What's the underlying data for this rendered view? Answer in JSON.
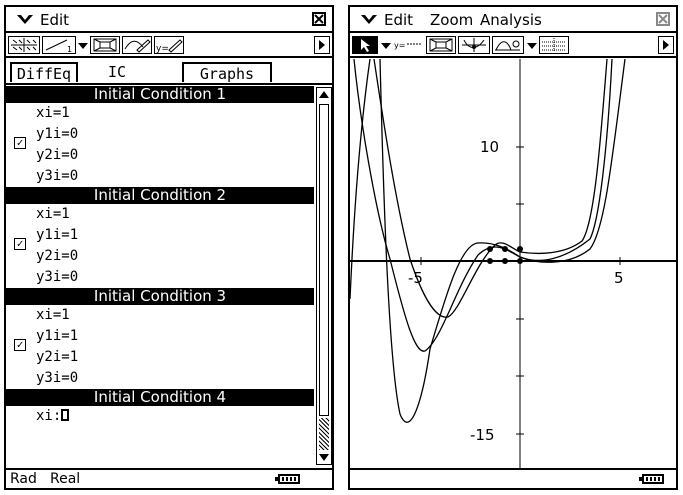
{
  "left_window": {
    "menu": {
      "edit": "Edit"
    },
    "toolbar": {
      "buttons": [
        "axes-field-icon",
        "line-1-icon",
        "zoom-box-icon",
        "draw-icon",
        "y-equals-graph-icon"
      ]
    },
    "tabs": [
      {
        "label": "DiffEq",
        "active": false
      },
      {
        "label": "IC",
        "active": true
      },
      {
        "label": "Graphs",
        "active": false
      }
    ],
    "conditions": [
      {
        "title": "Initial Condition 1",
        "checked": true,
        "lines": [
          "xi=1",
          "y1i=0",
          "y2i=0",
          "y3i=0"
        ]
      },
      {
        "title": "Initial Condition 2",
        "checked": true,
        "lines": [
          "xi=1",
          "y1i=1",
          "y2i=0",
          "y3i=0"
        ]
      },
      {
        "title": "Initial Condition 3",
        "checked": true,
        "lines": [
          "xi=1",
          "y1i=1",
          "y2i=1",
          "y3i=0"
        ]
      },
      {
        "title": "Initial Condition 4",
        "partial_line": "xi:"
      }
    ],
    "status": {
      "angle": "Rad",
      "mode": "Real"
    }
  },
  "right_window": {
    "menu": {
      "edit": "Edit",
      "zoom": "Zoom",
      "analysis": "Analysis"
    },
    "graph": {
      "x_tick_labels": [
        "-5",
        "5"
      ],
      "y_tick_labels": [
        "10",
        "-15"
      ]
    }
  }
}
